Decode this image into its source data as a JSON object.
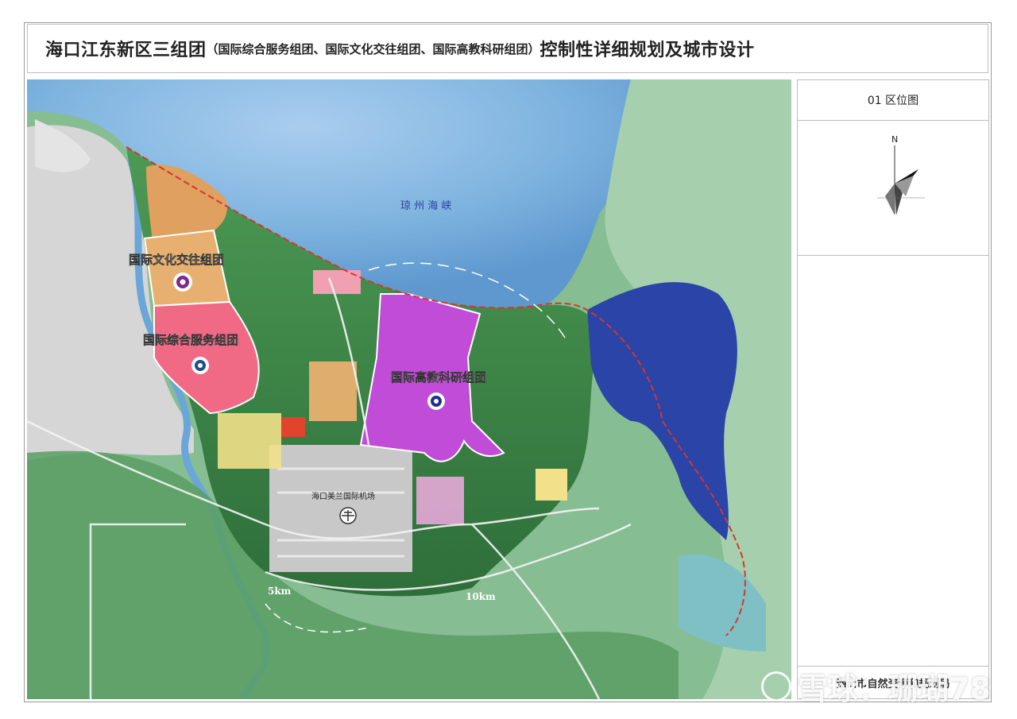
{
  "header": {
    "title": "海口江东新区三组团",
    "subtitle": "（国际综合服务组团、国际文化交往组团、国际高教科研组团）",
    "title_suffix": "控制性详细规划及城市设计"
  },
  "sidebar": {
    "drawing_title": "01  区位图",
    "north_label": "N",
    "agency": "海口市自然资源和规划局"
  },
  "map": {
    "sea_label": "琼  州  海  峡",
    "clusters": [
      {
        "name": "国际文化交往组团",
        "color": "#e8b070"
      },
      {
        "name": "国际综合服务组团",
        "color": "#f06a86"
      },
      {
        "name": "国际高教科研组团",
        "color": "#c04cd8"
      }
    ],
    "airport_label": "海口美兰国际机场",
    "ring_labels": [
      "5km",
      "10km"
    ],
    "colors": {
      "sea": "#7fb4df",
      "deep_sea": "#5e98cf",
      "bay": "#2a44a8",
      "vegetation": "#3e8a4a",
      "light_vegetation": "#8fc39a",
      "urban": "#d9d9d9",
      "boundary": "#d8362a"
    }
  },
  "watermark": "雪球：珊瑚78"
}
